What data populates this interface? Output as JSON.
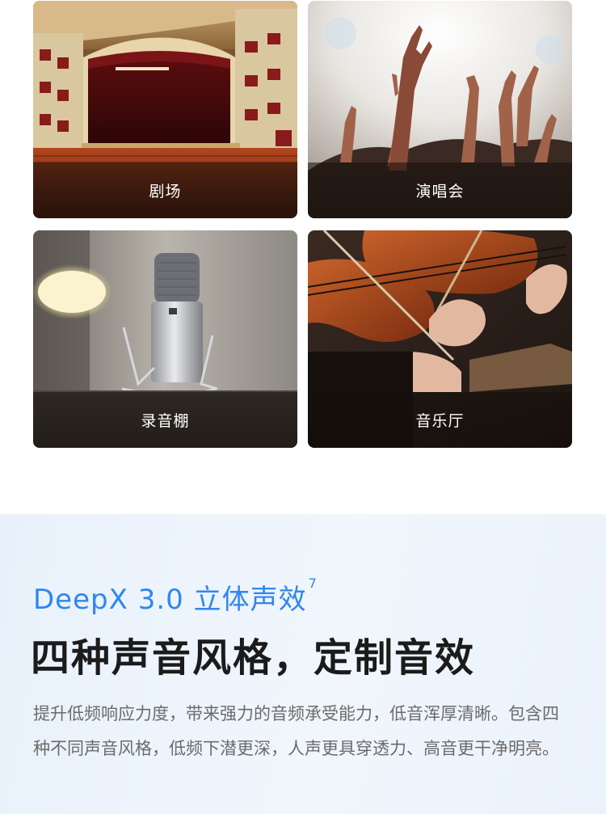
{
  "scenes": [
    {
      "label": "剧场"
    },
    {
      "label": "演唱会"
    },
    {
      "label": "录音棚"
    },
    {
      "label": "音乐厅"
    }
  ],
  "feature": {
    "eyebrow": "DeepX 3.0 立体声效",
    "eyebrow_footnote": "7",
    "headline": "四种声音风格，定制音效",
    "description": "提升低频响应力度，带来强力的音频承受能力，低音浑厚清晰。包含四种不同声音风格，低频下潜更深，人声更具穿透力、高音更干净明亮。"
  },
  "colors": {
    "accent": "#2f86f0",
    "headline": "#1b1b1b",
    "body": "#6b6b6b",
    "feature_bg": "#eaf2fb"
  }
}
